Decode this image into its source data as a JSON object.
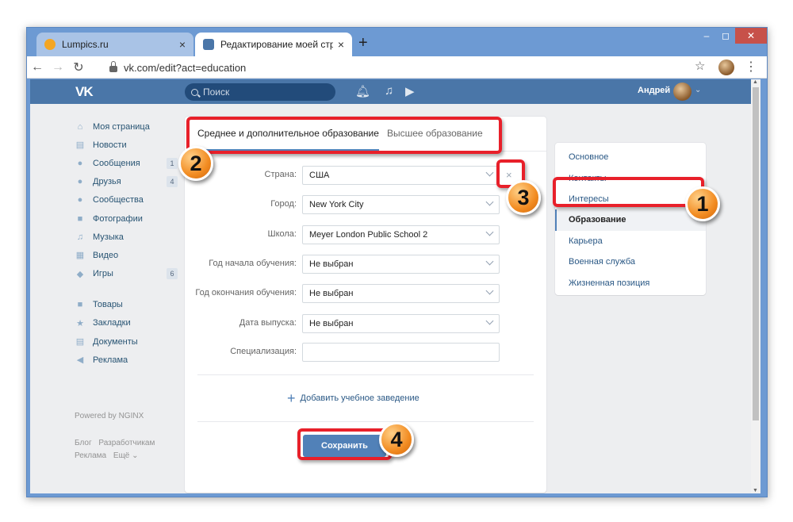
{
  "browser": {
    "tabs": [
      {
        "title": "Lumpics.ru",
        "favicon_color": "#f4a623"
      },
      {
        "title": "Редактирование моей страниц",
        "favicon_color": "#4a76a8"
      }
    ],
    "tab_close": "×",
    "new_tab": "+",
    "url": "vk.com/edit?act=education",
    "window_controls": {
      "minimize": "‒",
      "maximize": "◻",
      "close": "✕"
    }
  },
  "vk": {
    "logo": "VK",
    "search_placeholder": "Поиск",
    "user_name": "Андрей",
    "colors": {
      "header": "#4a76a8",
      "accent": "#5181b8",
      "link": "#2a5885"
    }
  },
  "left_nav": {
    "group1": [
      {
        "icon": "home-icon",
        "glyph": "⌂",
        "label": "Моя страница",
        "count": ""
      },
      {
        "icon": "news-icon",
        "glyph": "▤",
        "label": "Новости",
        "count": ""
      },
      {
        "icon": "messages-icon",
        "glyph": "●",
        "label": "Сообщения",
        "count": "1"
      },
      {
        "icon": "friends-icon",
        "glyph": "●",
        "label": "Друзья",
        "count": "4"
      },
      {
        "icon": "communities-icon",
        "glyph": "●",
        "label": "Сообщества",
        "count": ""
      },
      {
        "icon": "photos-icon",
        "glyph": "■",
        "label": "Фотографии",
        "count": ""
      },
      {
        "icon": "music-icon",
        "glyph": "♫",
        "label": "Музыка",
        "count": ""
      },
      {
        "icon": "video-icon",
        "glyph": "▦",
        "label": "Видео",
        "count": ""
      },
      {
        "icon": "games-icon",
        "glyph": "◆",
        "label": "Игры",
        "count": "6"
      }
    ],
    "group2": [
      {
        "icon": "goods-icon",
        "glyph": "■",
        "label": "Товары"
      },
      {
        "icon": "bookmarks-icon",
        "glyph": "★",
        "label": "Закладки"
      },
      {
        "icon": "documents-icon",
        "glyph": "▤",
        "label": "Документы"
      },
      {
        "icon": "ads-icon",
        "glyph": "◀",
        "label": "Реклама"
      }
    ],
    "powered_by": "Powered by NGINX",
    "footer_links": [
      "Блог",
      "Разработчикам",
      "Реклама",
      "Ещё ⌄"
    ]
  },
  "education": {
    "tab_secondary": "Среднее и дополнительное образование",
    "tab_higher": "Высшее образование",
    "fields": [
      {
        "label": "Страна:",
        "value": "США"
      },
      {
        "label": "Город:",
        "value": "New York City"
      },
      {
        "label": "Школа:",
        "value": "Meyer London Public School 2"
      },
      {
        "label": "Год начала обучения:",
        "value": "Не выбран"
      },
      {
        "label": "Год окончания обучения:",
        "value": "Не выбран"
      },
      {
        "label": "Дата выпуска:",
        "value": "Не выбран"
      },
      {
        "label": "Специализация:",
        "value": ""
      }
    ],
    "clear_glyph": "×",
    "add_link": "Добавить учебное заведение",
    "save_label": "Сохранить"
  },
  "right_menu": {
    "items": [
      "Основное",
      "Контакты",
      "Интересы",
      "Образование",
      "Карьера",
      "Военная служба",
      "Жизненная позиция"
    ],
    "selected": "Образование"
  },
  "annotations": {
    "badges": [
      "1",
      "2",
      "3",
      "4"
    ],
    "highlight_color": "#e8202a",
    "badge_color": "#f28c22"
  }
}
